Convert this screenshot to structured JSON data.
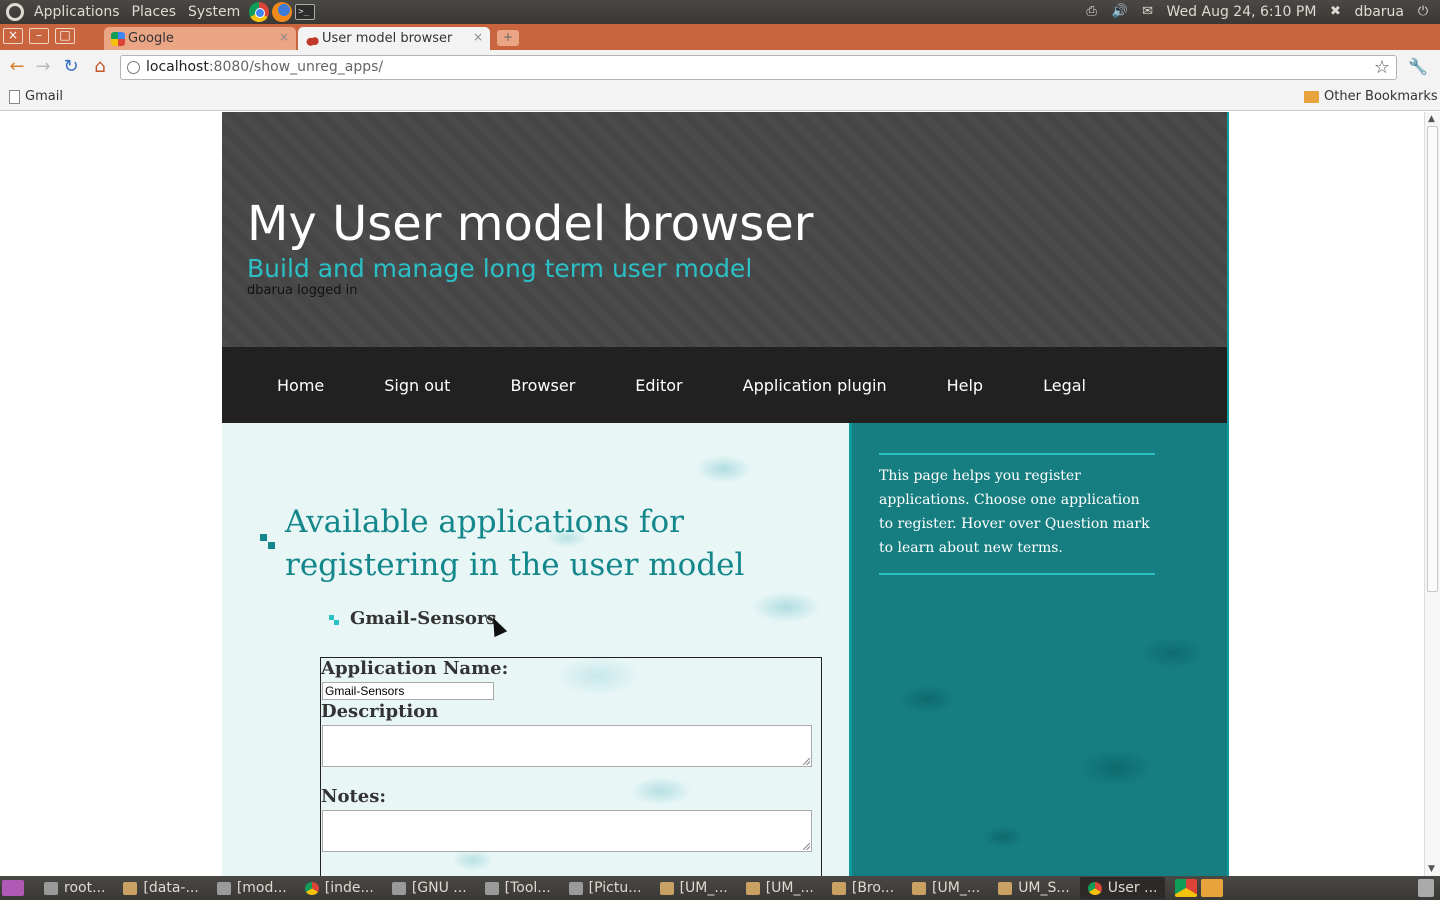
{
  "panel": {
    "menus": [
      "Applications",
      "Places",
      "System"
    ],
    "datetime": "Wed Aug 24,  6:10 PM",
    "user": "dbarua"
  },
  "browser": {
    "tabs": [
      {
        "title": "Google"
      },
      {
        "title": "User model browser"
      }
    ],
    "url_host": "localhost",
    "url_rest": ":8080/show_unreg_apps/",
    "bookmarks": {
      "gmail": "Gmail",
      "other": "Other Bookmarks"
    }
  },
  "site": {
    "title": "My User model browser",
    "tagline": "Build and manage long term user model",
    "login_status": "dbarua logged in",
    "nav": [
      "Home",
      "Sign out",
      "Browser",
      "Editor",
      "Application plugin",
      "Help",
      "Legal"
    ],
    "section_title": "Available applications for registering in the user model",
    "app_item": "Gmail-Sensors",
    "form": {
      "app_name_label": "Application Name:",
      "app_name_value": "Gmail-Sensors",
      "description_label": "Description",
      "notes_label": "Notes:"
    },
    "sidebar_note": "This page helps you register applications. Choose one application to register. Hover over Question mark to learn about new terms."
  },
  "taskbar": {
    "tasks": [
      "root...",
      "[data-...",
      "[mod...",
      "[inde...",
      "[GNU ...",
      "[Tool...",
      "[Pictu...",
      "[UM_...",
      "[UM_...",
      "[Bro...",
      "[UM_...",
      "UM_S...",
      "User ..."
    ]
  },
  "colors": {
    "accent_teal": "#13878b",
    "tagline_cyan": "#2bc0c6",
    "tabstrip_orange": "#c8643e",
    "sidebar_teal": "#167d80"
  }
}
